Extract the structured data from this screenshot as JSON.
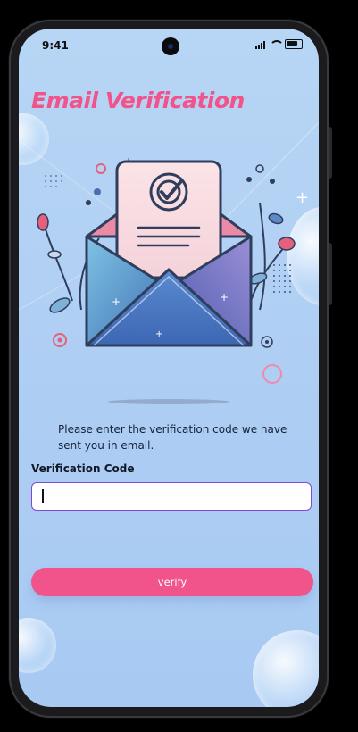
{
  "status_bar": {
    "time": "9:41"
  },
  "screen": {
    "title": "Email Verification",
    "instruction": "Please enter the verification code we have sent you in email.",
    "code_label": "Verification Code",
    "code_value": "",
    "code_placeholder": "",
    "verify_label": "verify"
  },
  "colors": {
    "accent": "#f1548a",
    "background": "#b7d6f5",
    "input_border": "#7d4bd6"
  }
}
